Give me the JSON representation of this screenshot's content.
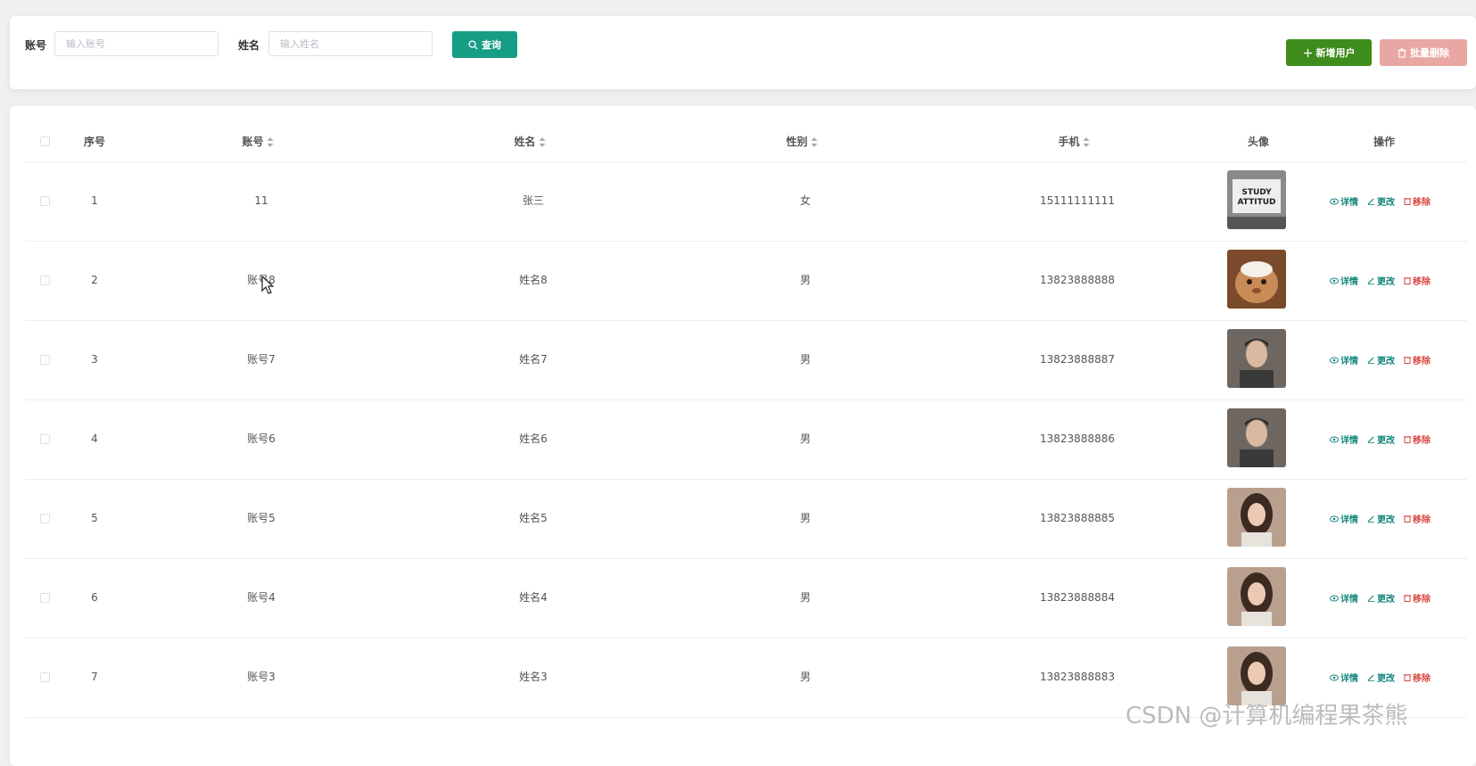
{
  "search": {
    "account_label": "账号",
    "account_placeholder": "输入账号",
    "name_label": "姓名",
    "name_placeholder": "输入姓名",
    "query_button": "查询"
  },
  "toolbar": {
    "add_user": "新增用户",
    "batch_delete": "批量删除"
  },
  "table": {
    "columns": {
      "index": "序号",
      "account": "账号",
      "name": "姓名",
      "gender": "性别",
      "phone": "手机",
      "avatar": "头像",
      "actions": "操作"
    },
    "action_labels": {
      "detail": "详情",
      "edit": "更改",
      "remove": "移除"
    },
    "rows": [
      {
        "index": "1",
        "account": "11",
        "name": "张三",
        "gender": "女",
        "phone": "15111111111",
        "avatar": "study-attitude-image"
      },
      {
        "index": "2",
        "account": "账号8",
        "name": "姓名8",
        "gender": "男",
        "phone": "13823888888",
        "avatar": "cat-photo"
      },
      {
        "index": "3",
        "account": "账号7",
        "name": "姓名7",
        "gender": "男",
        "phone": "13823888887",
        "avatar": "man-portrait"
      },
      {
        "index": "4",
        "account": "账号6",
        "name": "姓名6",
        "gender": "男",
        "phone": "13823888886",
        "avatar": "man-portrait"
      },
      {
        "index": "5",
        "account": "账号5",
        "name": "姓名5",
        "gender": "男",
        "phone": "13823888885",
        "avatar": "woman-portrait"
      },
      {
        "index": "6",
        "account": "账号4",
        "name": "姓名4",
        "gender": "男",
        "phone": "13823888884",
        "avatar": "woman-portrait"
      },
      {
        "index": "7",
        "account": "账号3",
        "name": "姓名3",
        "gender": "男",
        "phone": "13823888883",
        "avatar": "woman-portrait"
      }
    ]
  },
  "watermark": "CSDN @计算机编程果茶熊",
  "colors": {
    "primary": "#169d86",
    "add": "#3e8c1b",
    "danger": "#d9473f",
    "danger_disabled": "#e9a7a3"
  }
}
